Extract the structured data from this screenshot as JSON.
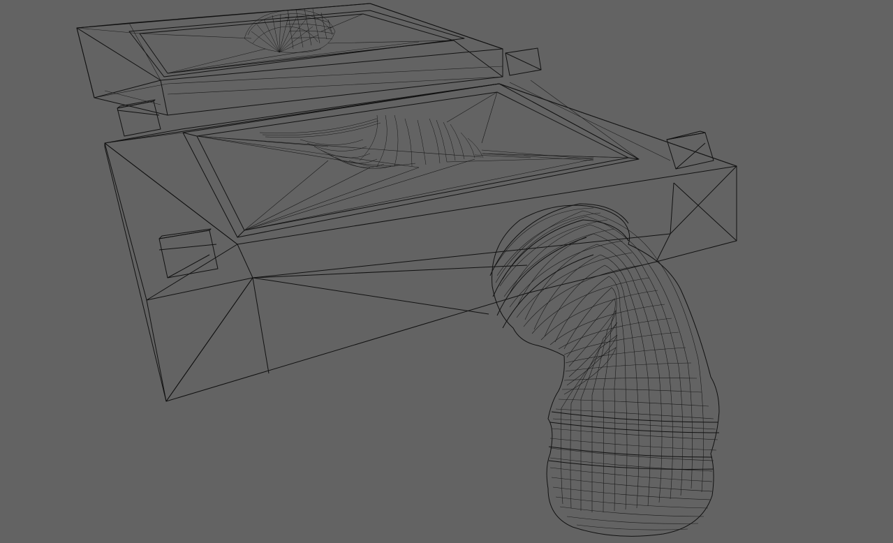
{
  "viewport": {
    "background_color": "#636363",
    "wire_color": "#111111",
    "render_mode": "wireframe"
  },
  "scene": {
    "objects": [
      {
        "name": "base-tray",
        "label": ""
      },
      {
        "name": "pipe-elbow",
        "label": ""
      }
    ]
  }
}
